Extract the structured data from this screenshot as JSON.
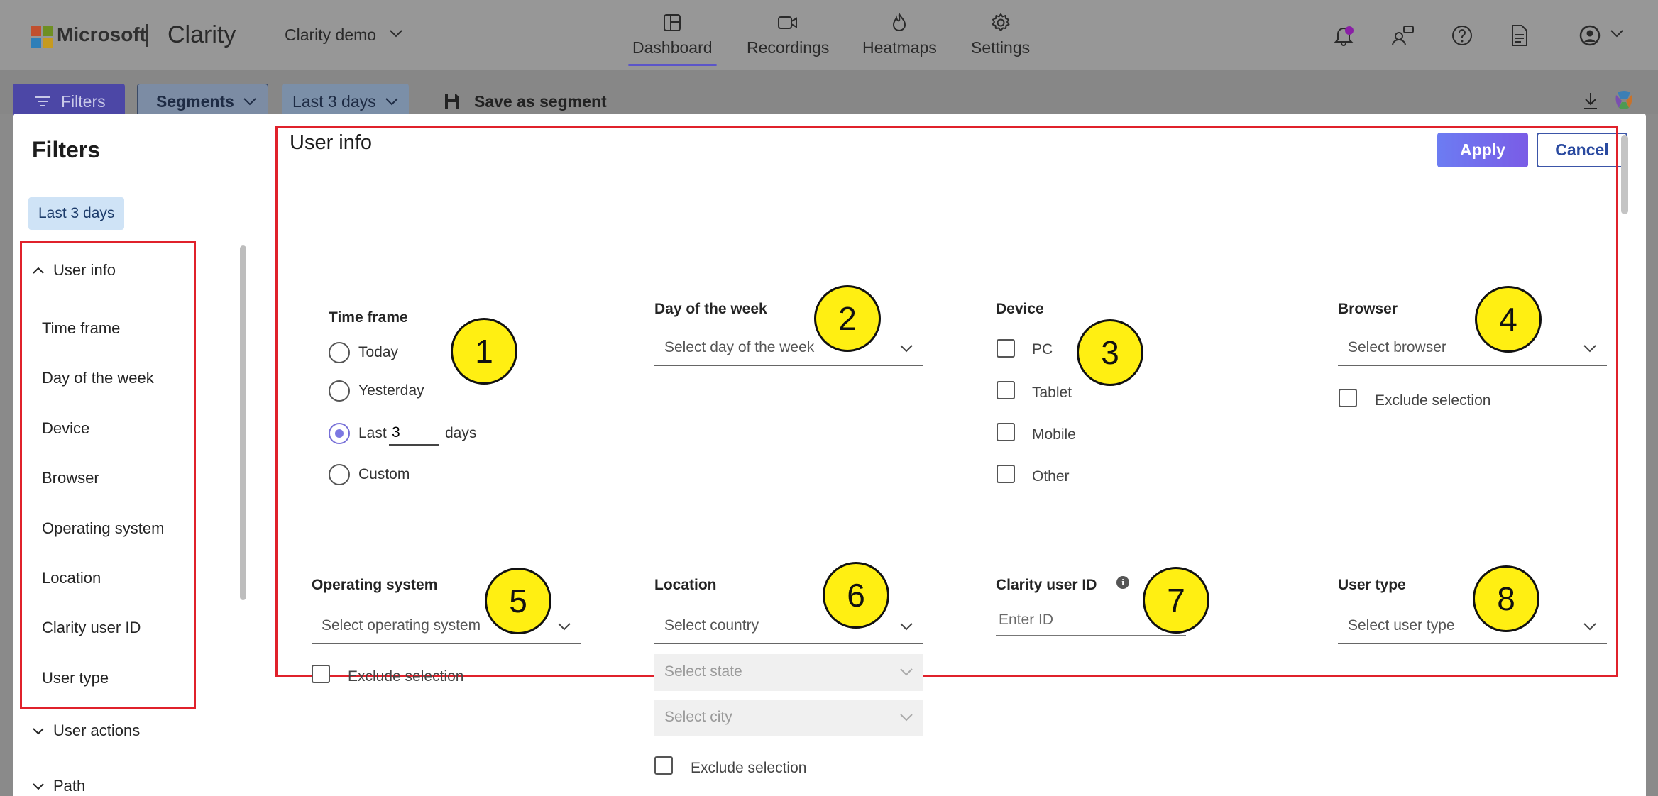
{
  "topnav": {
    "brand": "Microsoft",
    "app_name": "Clarity",
    "project": "Clarity demo",
    "tabs": [
      {
        "label": "Dashboard",
        "icon": "dashboard-icon"
      },
      {
        "label": "Recordings",
        "icon": "video-icon"
      },
      {
        "label": "Heatmaps",
        "icon": "flame-icon"
      },
      {
        "label": "Settings",
        "icon": "gear-icon"
      }
    ],
    "active_tab": "Dashboard",
    "right_icons": [
      "bell-icon",
      "people-icon",
      "help-icon",
      "document-icon",
      "account-icon"
    ]
  },
  "toolbar": {
    "filters_label": "Filters",
    "segments_label": "Segments",
    "range_label": "Last 3 days",
    "save_label": "Save as segment"
  },
  "modal": {
    "title": "Filters",
    "apply_label": "Apply",
    "cancel_label": "Cancel",
    "active_chip": "Last 3 days"
  },
  "sidebar": {
    "group_user_info": "User info",
    "items": [
      "Time frame",
      "Day of the week",
      "Device",
      "Browser",
      "Operating system",
      "Location",
      "Clarity user ID",
      "User type"
    ],
    "group_user_actions": "User actions",
    "group_path": "Path"
  },
  "content": {
    "section_title": "User info",
    "time_frame": {
      "label": "Time frame",
      "today": "Today",
      "yesterday": "Yesterday",
      "last": "Last",
      "last_value": "3",
      "days": "days",
      "custom": "Custom",
      "selected": "Last"
    },
    "day_of_week": {
      "label": "Day of the week",
      "placeholder": "Select day of the week"
    },
    "device": {
      "label": "Device",
      "options": [
        "PC",
        "Tablet",
        "Mobile",
        "Other"
      ]
    },
    "browser": {
      "label": "Browser",
      "placeholder": "Select browser",
      "exclude": "Exclude selection"
    },
    "os": {
      "label": "Operating system",
      "placeholder": "Select operating system",
      "exclude": "Exclude selection"
    },
    "location": {
      "label": "Location",
      "country": "Select country",
      "state": "Select state",
      "city": "Select city",
      "exclude": "Exclude selection"
    },
    "user_id": {
      "label": "Clarity user ID",
      "placeholder": "Enter ID"
    },
    "user_type": {
      "label": "User type",
      "placeholder": "Select user type"
    }
  },
  "markers": [
    "1",
    "2",
    "3",
    "4",
    "5",
    "6",
    "7",
    "8"
  ],
  "colors": {
    "accent": "#7770d8",
    "highlight_box": "#e0212b",
    "marker_fill": "#ffef12",
    "chip_bg": "#cfe3f6"
  }
}
